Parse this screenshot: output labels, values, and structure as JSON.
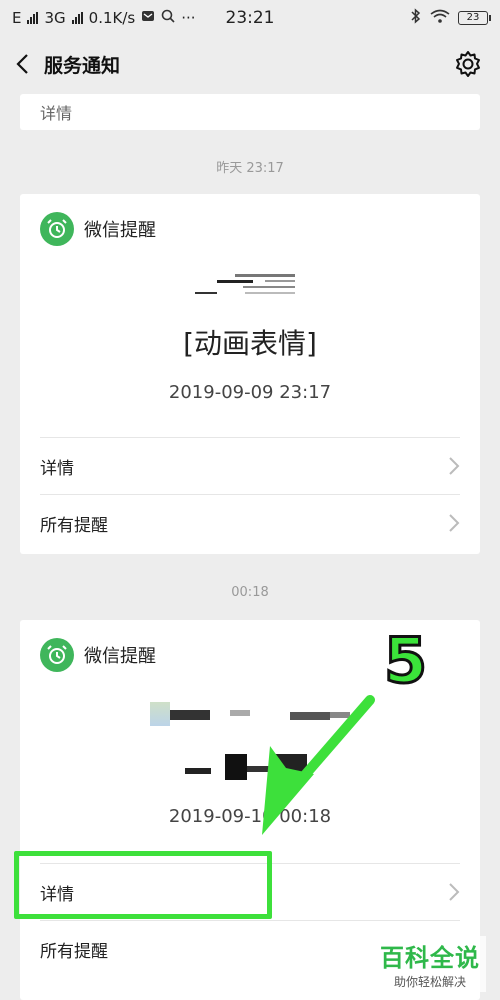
{
  "status_bar": {
    "carrier_left": "E",
    "network": "3G",
    "speed": "0.1K/s",
    "time": "23:21",
    "battery": "23"
  },
  "nav": {
    "title": "服务通知",
    "back_icon": "chevron-left-icon",
    "settings_icon": "gear-icon"
  },
  "partial_card": {
    "row_label": "详情"
  },
  "notifications": [
    {
      "time": "昨天 23:17",
      "app_name": "微信提醒",
      "app_icon": "alarm-clock-icon",
      "main_text": "[动画表情]",
      "date": "2019-09-09 23:17",
      "rows": [
        "详情",
        "所有提醒"
      ]
    },
    {
      "time": "00:18",
      "app_name": "微信提醒",
      "app_icon": "alarm-clock-icon",
      "main_text": "",
      "date": "2019-09-10 00:18",
      "rows": [
        "详情",
        "所有提醒"
      ]
    }
  ],
  "annotation": {
    "step": "5",
    "color": "#3de03b"
  },
  "watermark": {
    "title": "百科全说",
    "subtitle": "助你轻松解决"
  },
  "colors": {
    "background": "#ededed",
    "app_icon": "#3fb65b"
  }
}
